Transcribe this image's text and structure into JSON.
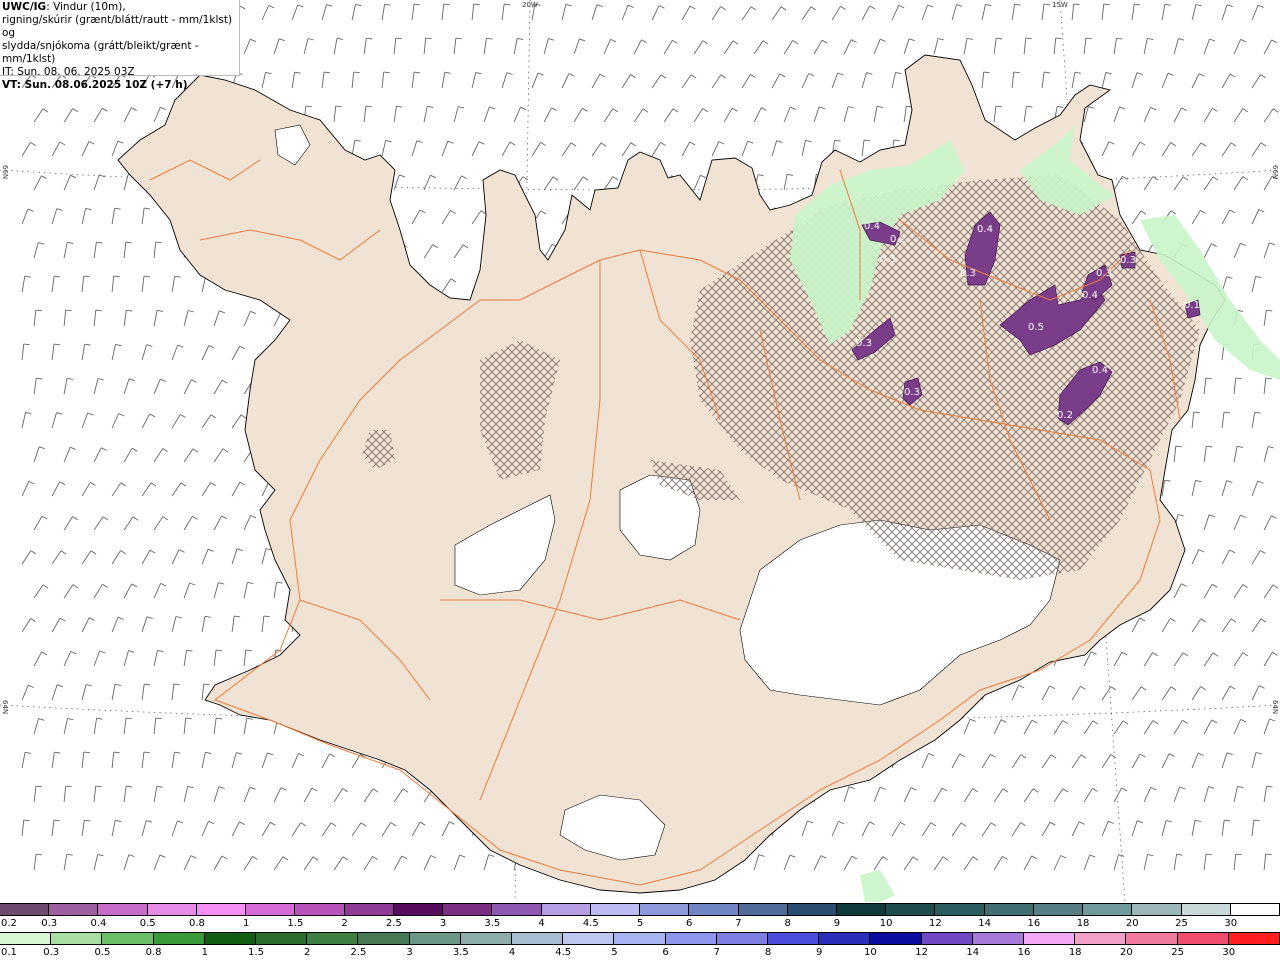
{
  "info": {
    "line1_bold": "UWC/IG",
    "line1_rest": ": Vindur (10m),",
    "line2": "rigning/skúrir (grænt/blátt/rautt - mm/1klst) og",
    "line3": "slydda/snjókoma (grátt/bleikt/grænt - mm/1klst)",
    "line4": "IT: Sun. 08. 06. 2025 03Z",
    "line5": "VT: Sun. 08.06.2025 10Z (+7 h)"
  },
  "grid_labels": {
    "lon_20w": "20W",
    "lon_15w": "15W",
    "lat_66n_left": "66N",
    "lat_66n_right": "66N",
    "lat_64n_left": "64N",
    "lat_64n_right": "64N"
  },
  "precip_labels": [
    "0.4",
    "0.2",
    "0.3",
    "0.4",
    "0.3",
    "0.3",
    "0.4",
    "0.3",
    "0.5",
    "0.3",
    "0.4",
    "0.2",
    "0.3",
    "0.1"
  ],
  "colors": {
    "land": "#f1e3d3",
    "roads": "#f07a3c",
    "sea": "#ffffff",
    "rain_light": "#c9f5c9",
    "snow_purple": "#7a3d8a"
  },
  "snow_scale": {
    "labels": [
      "0.2",
      "0.3",
      "0.4",
      "0.5",
      "0.8",
      "1",
      "1.5",
      "2",
      "2.5",
      "3",
      "3.5",
      "4",
      "4.5",
      "5",
      "6",
      "7",
      "8",
      "9",
      "10",
      "12",
      "14",
      "16",
      "18",
      "20",
      "25",
      "30"
    ],
    "colors": [
      "#6e4a6e",
      "#9d5fa0",
      "#c86ccc",
      "#e78ae8",
      "#f58ef5",
      "#d76ad9",
      "#b853bb",
      "#8f3a95",
      "#560b5d",
      "#7a2d82",
      "#8e57b3",
      "#b79de3",
      "#bcbcf2",
      "#8e98db",
      "#6f85c4",
      "#4f6b99",
      "#2a4c6f",
      "#0f3b3c",
      "#1d4d4f",
      "#2a5d60",
      "#3f6f72",
      "#557f85",
      "#6d9a9d",
      "#9cb7b9",
      "#c9d9d9",
      "#ffffff"
    ]
  },
  "rain_scale": {
    "labels": [
      "0.1",
      "0.3",
      "0.5",
      "0.8",
      "1",
      "1.5",
      "2",
      "2.5",
      "3",
      "3.5",
      "4",
      "4.5",
      "5",
      "6",
      "7",
      "8",
      "9",
      "10",
      "12",
      "14",
      "16",
      "18",
      "20",
      "25",
      "30"
    ],
    "colors": [
      "#d7f7d3",
      "#a6dfa0",
      "#6cbf66",
      "#3a9a3a",
      "#135d13",
      "#2b6e2b",
      "#3f7f44",
      "#467a55",
      "#6b9787",
      "#8cadac",
      "#a6bfd0",
      "#bcc8ef",
      "#a8b3f2",
      "#8f97ec",
      "#7c7ee2",
      "#4c4cdd",
      "#2d2dbb",
      "#0c0ca0",
      "#7247c3",
      "#a779d8",
      "#f2a8f2",
      "#f2a0c8",
      "#f07b9f",
      "#ef4e6f",
      "#ff1f1f"
    ]
  }
}
